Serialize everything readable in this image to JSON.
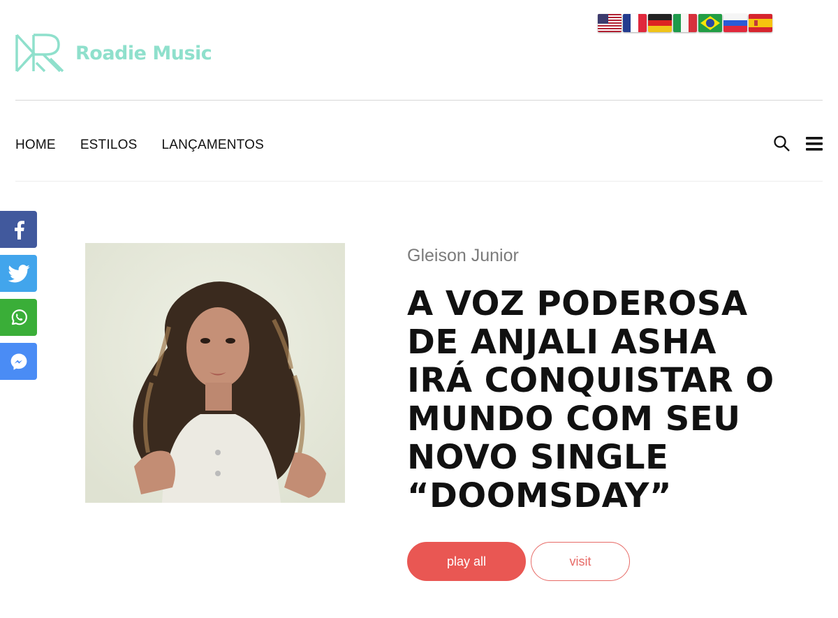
{
  "header": {
    "brand_name": "Roadie Music"
  },
  "languages": [
    {
      "name": "english-us-flag"
    },
    {
      "name": "french-flag"
    },
    {
      "name": "german-flag"
    },
    {
      "name": "italian-flag"
    },
    {
      "name": "brazilian-flag"
    },
    {
      "name": "russian-flag"
    },
    {
      "name": "spanish-flag"
    }
  ],
  "nav": {
    "items": [
      "HOME",
      "ESTILOS",
      "LANÇAMENTOS"
    ]
  },
  "share": [
    "facebook-icon",
    "twitter-icon",
    "whatsapp-icon",
    "messenger-icon"
  ],
  "article": {
    "author": "Gleison Junior",
    "title": "A VOZ PODEROSA DE ANJALI ASHA IRÁ CONQUISTAR O MUNDO COM SEU NOVO SINGLE “DOOMSDAY”"
  },
  "actions": {
    "play_label": "play all",
    "visit_label": "visit"
  },
  "colors": {
    "brand": "#8fe0cc",
    "accent": "#e95753",
    "facebook": "#41599d",
    "twitter": "#42a5ec",
    "whatsapp": "#3aae38",
    "messenger": "#4a8cf5"
  }
}
